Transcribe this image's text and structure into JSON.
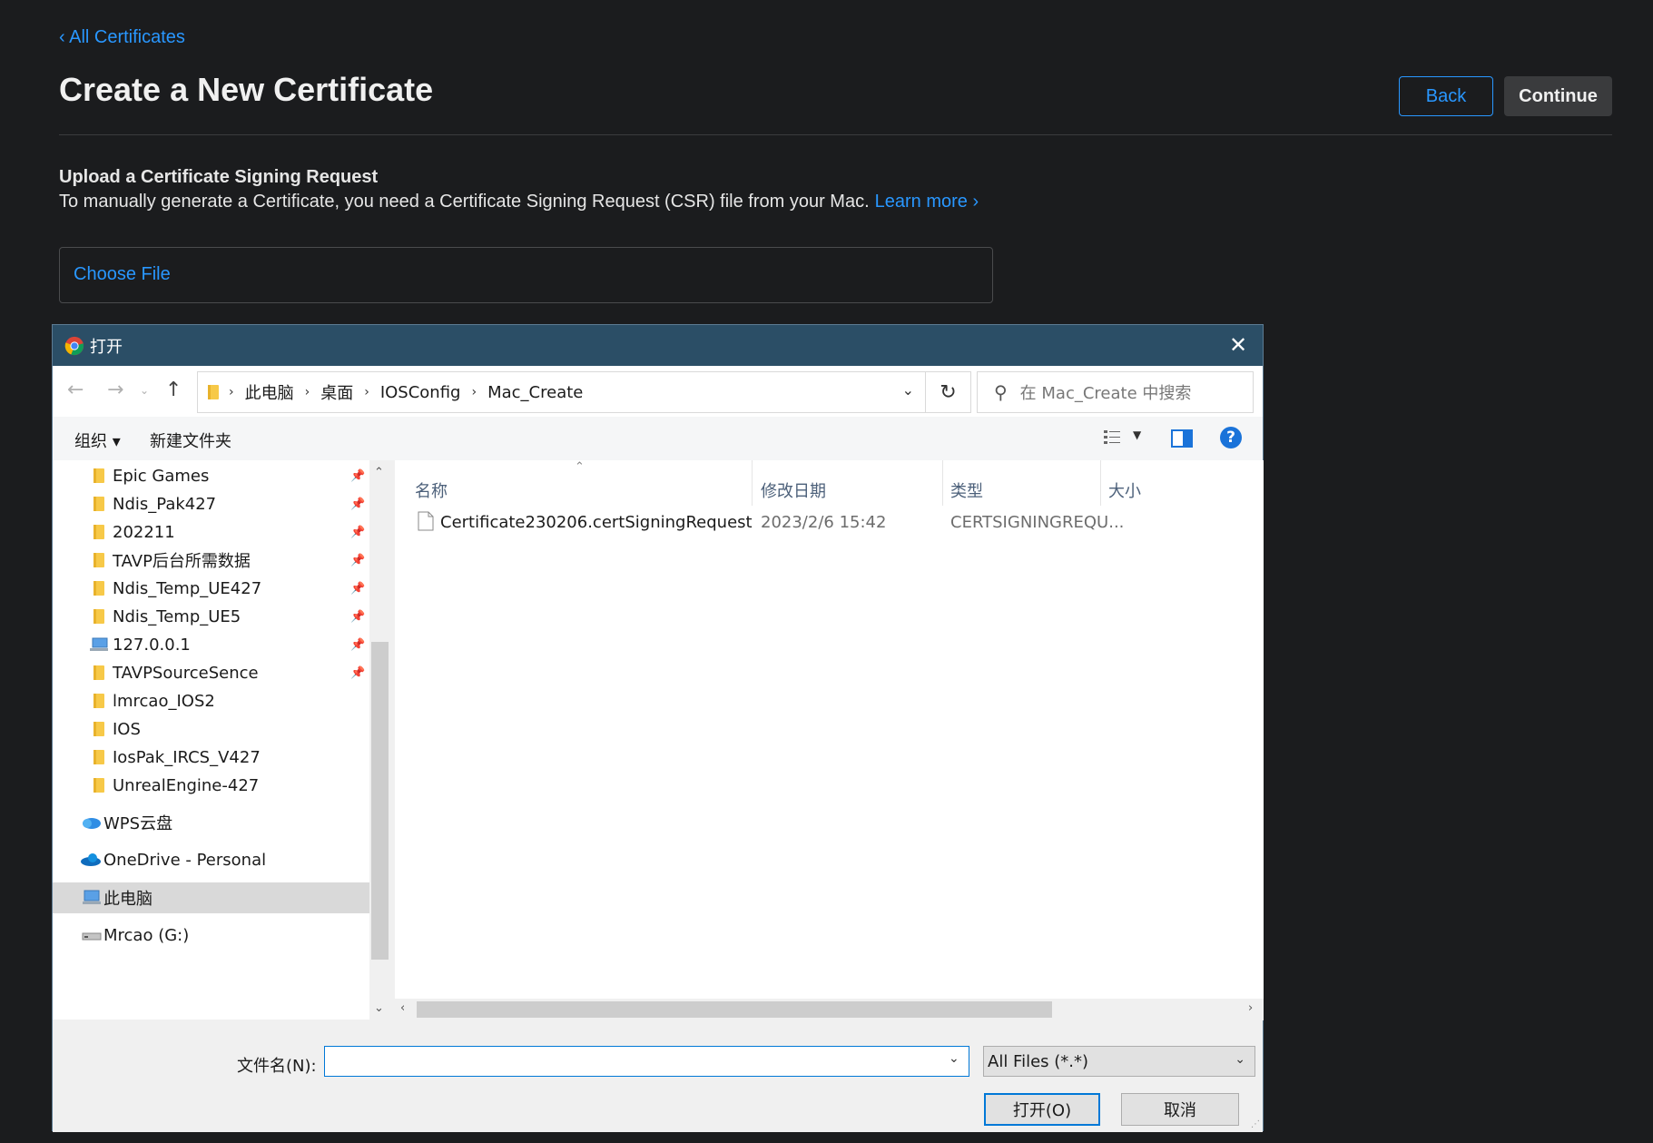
{
  "page": {
    "back_link": "‹ All Certificates",
    "title": "Create a New Certificate",
    "back_button": "Back",
    "continue_button": "Continue",
    "section_title": "Upload a Certificate Signing Request",
    "section_desc": "To manually generate a Certificate, you need a Certificate Signing Request (CSR) file from your Mac.",
    "learn_more": "Learn more ›",
    "choose_file": "Choose File",
    "colors": {
      "background": "#1b1c1e",
      "link": "#2997ff"
    }
  },
  "dialog": {
    "title": "打开",
    "title_icon": "chrome-icon",
    "breadcrumb": [
      "此电脑",
      "桌面",
      "IOSConfig",
      "Mac_Create"
    ],
    "search_placeholder": "在 Mac_Create 中搜索",
    "toolbar": {
      "organize": "组织 ▾",
      "new_folder": "新建文件夹"
    },
    "tree": [
      {
        "label": "Epic Games",
        "icon": "folder-icon",
        "pinned": true
      },
      {
        "label": "Ndis_Pak427",
        "icon": "folder-icon",
        "pinned": true
      },
      {
        "label": "202211",
        "icon": "folder-icon",
        "pinned": true
      },
      {
        "label": "TAVP后台所需数据",
        "icon": "folder-icon",
        "pinned": true
      },
      {
        "label": "Ndis_Temp_UE427",
        "icon": "folder-icon",
        "pinned": true
      },
      {
        "label": "Ndis_Temp_UE5",
        "icon": "folder-icon",
        "pinned": true
      },
      {
        "label": "127.0.0.1",
        "icon": "network-drive-icon",
        "pinned": true
      },
      {
        "label": "TAVPSourceSence",
        "icon": "folder-icon",
        "pinned": true
      },
      {
        "label": "lmrcao_IOS2",
        "icon": "folder-icon",
        "pinned": false
      },
      {
        "label": "IOS",
        "icon": "folder-icon",
        "pinned": false
      },
      {
        "label": "IosPak_IRCS_V427",
        "icon": "folder-icon",
        "pinned": false
      },
      {
        "label": "UnrealEngine-427",
        "icon": "folder-icon",
        "pinned": false
      },
      {
        "label": "WPS云盘",
        "icon": "cloud-icon",
        "pinned": false
      },
      {
        "label": "OneDrive - Personal",
        "icon": "onedrive-icon",
        "pinned": false
      },
      {
        "label": "此电脑",
        "icon": "computer-icon",
        "pinned": false,
        "selected": true
      },
      {
        "label": "Mrcao (G:)",
        "icon": "drive-icon",
        "pinned": false
      }
    ],
    "columns": [
      "名称",
      "修改日期",
      "类型",
      "大小"
    ],
    "files": [
      {
        "name": "Certificate230206.certSigningRequest",
        "date": "2023/2/6 15:42",
        "type": "CERTSIGNINGREQU..."
      }
    ],
    "filename_label": "文件名(N):",
    "filename_value": "",
    "filetype": "All Files (*.*)",
    "open_button": "打开(O)",
    "cancel_button": "取消"
  }
}
